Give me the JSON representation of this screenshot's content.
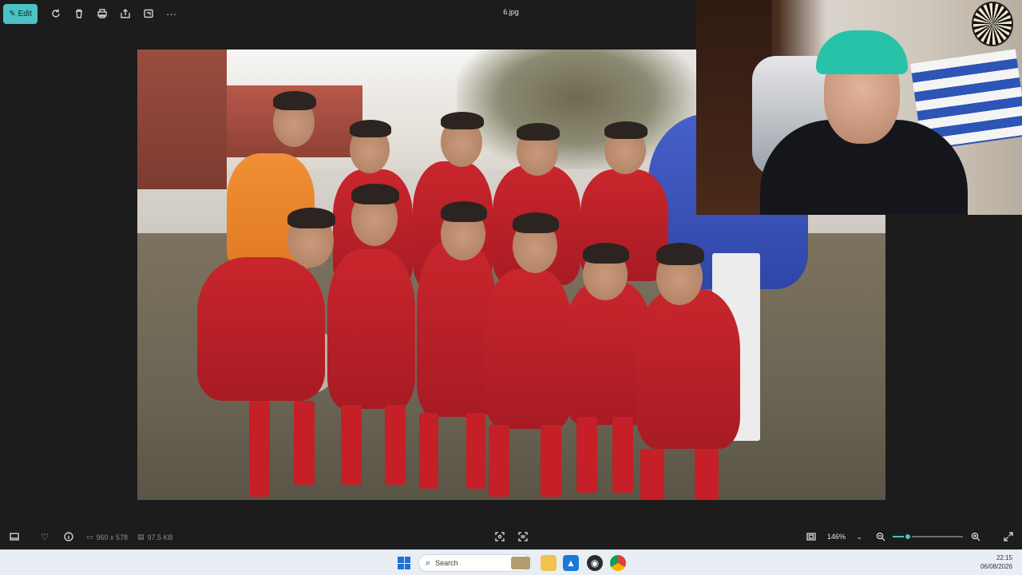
{
  "toolbar": {
    "edit_label": "Edit",
    "filename": "6.jpg"
  },
  "photo": {
    "description_alt": "Team photo of young football players"
  },
  "bottom": {
    "dimensions": "960 x 578",
    "filesize": "97.5 KB",
    "zoom": "146%",
    "zoom_fraction": 0.22
  },
  "taskbar": {
    "search_placeholder": "Search",
    "time": "22:15",
    "date": "06/08/2026"
  },
  "colors": {
    "accent": "#4cc2c4",
    "viewer_bg": "#1c1c1c",
    "taskbar_bg": "#e9eef4"
  },
  "icons": [
    "edit-icon",
    "rotate-icon",
    "delete-icon",
    "print-icon",
    "share-icon",
    "crop-icon",
    "more-icon",
    "filmstrip-icon",
    "favorite-icon",
    "info-icon",
    "image-size-icon",
    "file-size-icon",
    "select-icon",
    "ocr-icon",
    "fit-icon",
    "zoom-out-icon",
    "zoom-in-icon",
    "fullscreen-icon"
  ]
}
